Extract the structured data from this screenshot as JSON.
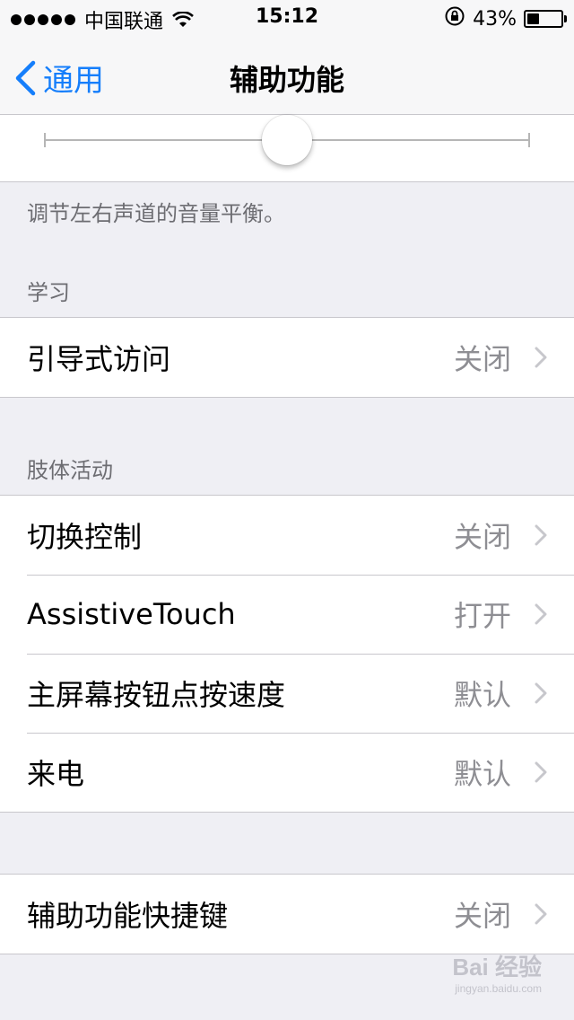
{
  "status_bar": {
    "carrier": "中国联通",
    "time": "15:12",
    "battery_percent": "43%",
    "battery_level": 0.43,
    "icons": [
      "signal-dots-icon",
      "wifi-icon",
      "orientation-lock-icon",
      "battery-icon"
    ]
  },
  "nav": {
    "back_label": "通用",
    "title": "辅助功能"
  },
  "balance_slider": {
    "value": 0.5
  },
  "balance_caption": "调节左右声道的音量平衡。",
  "sections": {
    "learning": {
      "header": "学习",
      "rows": [
        {
          "label": "引导式访问",
          "value": "关闭"
        }
      ]
    },
    "physical": {
      "header": "肢体活动",
      "rows": [
        {
          "label": "切换控制",
          "value": "关闭"
        },
        {
          "label": "AssistiveTouch",
          "value": "打开"
        },
        {
          "label": "主屏幕按钮点按速度",
          "value": "默认"
        },
        {
          "label": "来电",
          "value": "默认"
        }
      ]
    },
    "shortcut": {
      "rows": [
        {
          "label": "辅助功能快捷键",
          "value": "关闭"
        }
      ]
    }
  },
  "watermark": {
    "text": "Bai 经验",
    "sub": "jingyan.baidu.com"
  },
  "colors": {
    "accent": "#157efb",
    "background": "#efeff4",
    "separator": "#c8c7cc",
    "secondary_text": "#8e8e93"
  }
}
